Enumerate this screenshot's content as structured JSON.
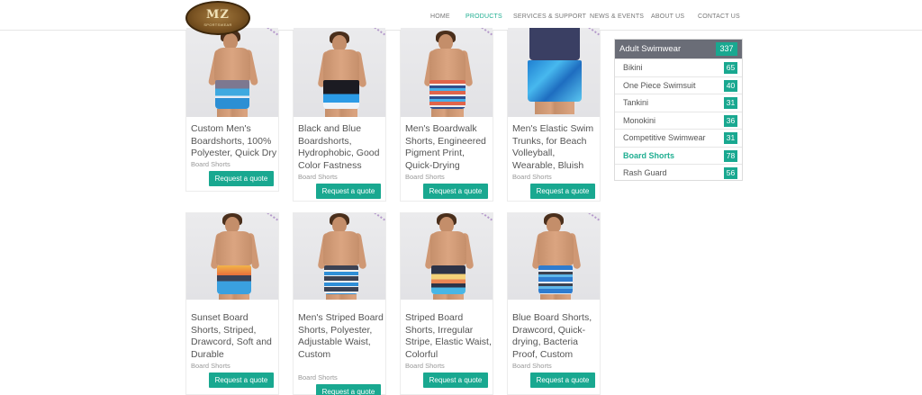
{
  "header": {
    "logo_text": "MZ",
    "logo_sub": "SPORTSWEAR",
    "nav": [
      {
        "label": "HOME",
        "active": false
      },
      {
        "label": "PRODUCTS",
        "active": true
      },
      {
        "label": "SERVICES & SUPPORT",
        "active": false
      },
      {
        "label": "NEWS & EVENTS",
        "active": false
      },
      {
        "label": "ABOUT US",
        "active": false
      },
      {
        "label": "CONTACT US",
        "active": false
      }
    ]
  },
  "products": [
    {
      "title": "Custom Men's Boardshorts, 100% Polyester, Quick Dry",
      "category": "Board Shorts",
      "button": "Request a quote"
    },
    {
      "title": "Black and Blue Boardshorts, Hydrophobic, Good Color Fastness",
      "category": "Board Shorts",
      "button": "Request a quote"
    },
    {
      "title": "Men's Boardwalk Shorts, Engineered Pigment Print, Quick-Drying",
      "category": "Board Shorts",
      "button": "Request a quote"
    },
    {
      "title": "Men's Elastic Swim Trunks, for Beach Volleyball, Wearable, Bluish",
      "category": "Board Shorts",
      "button": "Request a quote"
    },
    {
      "title": "Sunset Board Shorts, Striped, Drawcord, Soft and Durable",
      "category": "Board Shorts",
      "button": "Request a quote"
    },
    {
      "title": "Men's Striped Board Shorts, Polyester, Adjustable Waist, Custom",
      "category": "Board Shorts",
      "button": "Request a quote"
    },
    {
      "title": "Striped Board Shorts, Irregular Stripe, Elastic Waist, Colorful",
      "category": "Board Shorts",
      "button": "Request a quote"
    },
    {
      "title": "Blue Board Shorts, Drawcord, Quick-drying, Bacteria Proof, Custom",
      "category": "Board Shorts",
      "button": "Request a quote"
    }
  ],
  "sidebar": {
    "title": "Adult Swimwear",
    "count": "337",
    "items": [
      {
        "label": "Bikini",
        "count": "65",
        "active": false
      },
      {
        "label": "One Piece Swimsuit",
        "count": "40",
        "active": false
      },
      {
        "label": "Tankini",
        "count": "31",
        "active": false
      },
      {
        "label": "Monokini",
        "count": "36",
        "active": false
      },
      {
        "label": "Competitive Swimwear",
        "count": "31",
        "active": false
      },
      {
        "label": "Board Shorts",
        "count": "78",
        "active": true
      },
      {
        "label": "Rash Guard",
        "count": "56",
        "active": false
      }
    ]
  },
  "colors": {
    "accent": "#19a890",
    "active_text": "#1fae91",
    "sidebar_header": "#6a6d77"
  }
}
